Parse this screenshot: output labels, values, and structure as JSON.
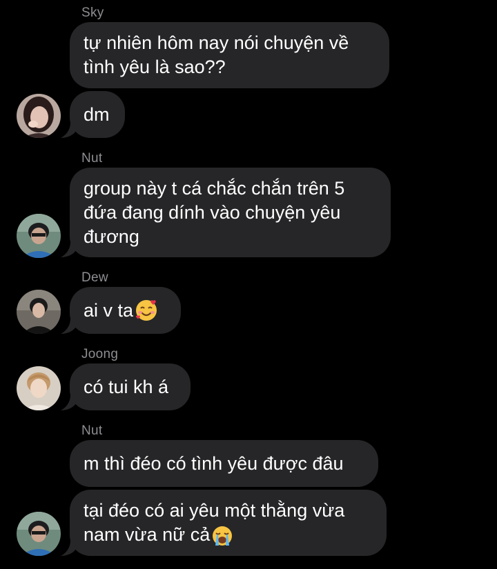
{
  "messages": [
    {
      "sender": "Sky",
      "lines": "tự nhiên hôm nay nói chuyện về\ntình yêu là sao??"
    },
    {
      "text": "dm"
    },
    {
      "sender": "Nut",
      "lines": "group này t cá chắc chắn trên 5\nđứa đang dính vào chuyện yêu\nđương"
    },
    {
      "sender": "Dew",
      "text": "ai v ta",
      "emoji": "smiling-face-with-hearts"
    },
    {
      "sender": "Joong",
      "text": "có tui kh á"
    },
    {
      "sender": "Nut",
      "text": "m thì đéo có tình yêu được đâu"
    },
    {
      "lines": "tại đéo có ai yêu một thằng vừa\nnam vừa nữ cả",
      "emoji": "loudly-crying-face"
    }
  ],
  "colors": {
    "background": "#000000",
    "bubble": "#262628",
    "sender_name": "#8e8e93",
    "text": "#ffffff"
  }
}
